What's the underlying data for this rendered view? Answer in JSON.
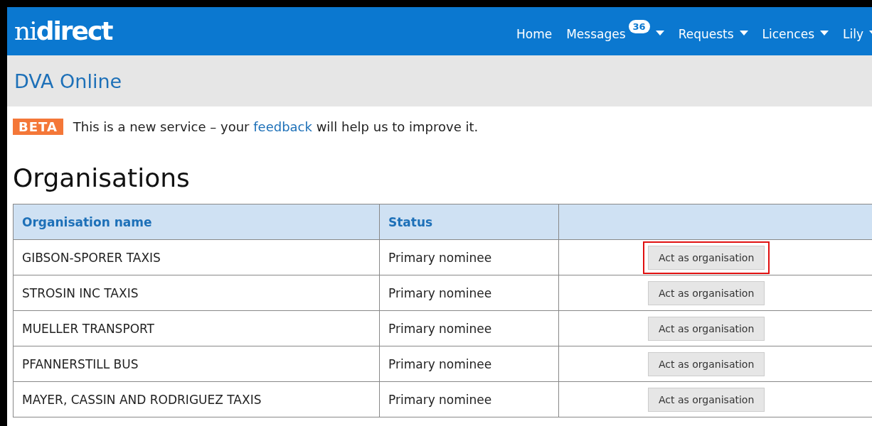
{
  "header": {
    "logo": {
      "light": "ni",
      "bold": "direct"
    },
    "nav": [
      {
        "label": "Home",
        "dropdown": false
      },
      {
        "label": "Messages",
        "badge": "36",
        "dropdown": true
      },
      {
        "label": "Requests",
        "dropdown": true
      },
      {
        "label": "Licences",
        "dropdown": true
      },
      {
        "label": "Lily",
        "dropdown": true
      }
    ]
  },
  "service_bar": {
    "title": "DVA Online"
  },
  "banner": {
    "tag": "BETA",
    "before": "This is a new service – your",
    "link": "feedback",
    "after": "will help us to improve it."
  },
  "heading": "Organisations",
  "table": {
    "columns": [
      "Organisation name",
      "Status"
    ],
    "rows": [
      {
        "name": "GIBSON-SPORER TAXIS",
        "status": "Primary nominee",
        "action": "Act as organisation",
        "highlighted": true
      },
      {
        "name": "STROSIN INC TAXIS",
        "status": "Primary nominee",
        "action": "Act as organisation",
        "highlighted": false
      },
      {
        "name": "MUELLER TRANSPORT",
        "status": "Primary nominee",
        "action": "Act as organisation",
        "highlighted": false
      },
      {
        "name": "PFANNERSTILL BUS",
        "status": "Primary nominee",
        "action": "Act as organisation",
        "highlighted": false
      },
      {
        "name": "MAYER, CASSIN AND RODRIGUEZ TAXIS",
        "status": "Primary nominee",
        "action": "Act as organisation",
        "highlighted": false
      }
    ]
  }
}
